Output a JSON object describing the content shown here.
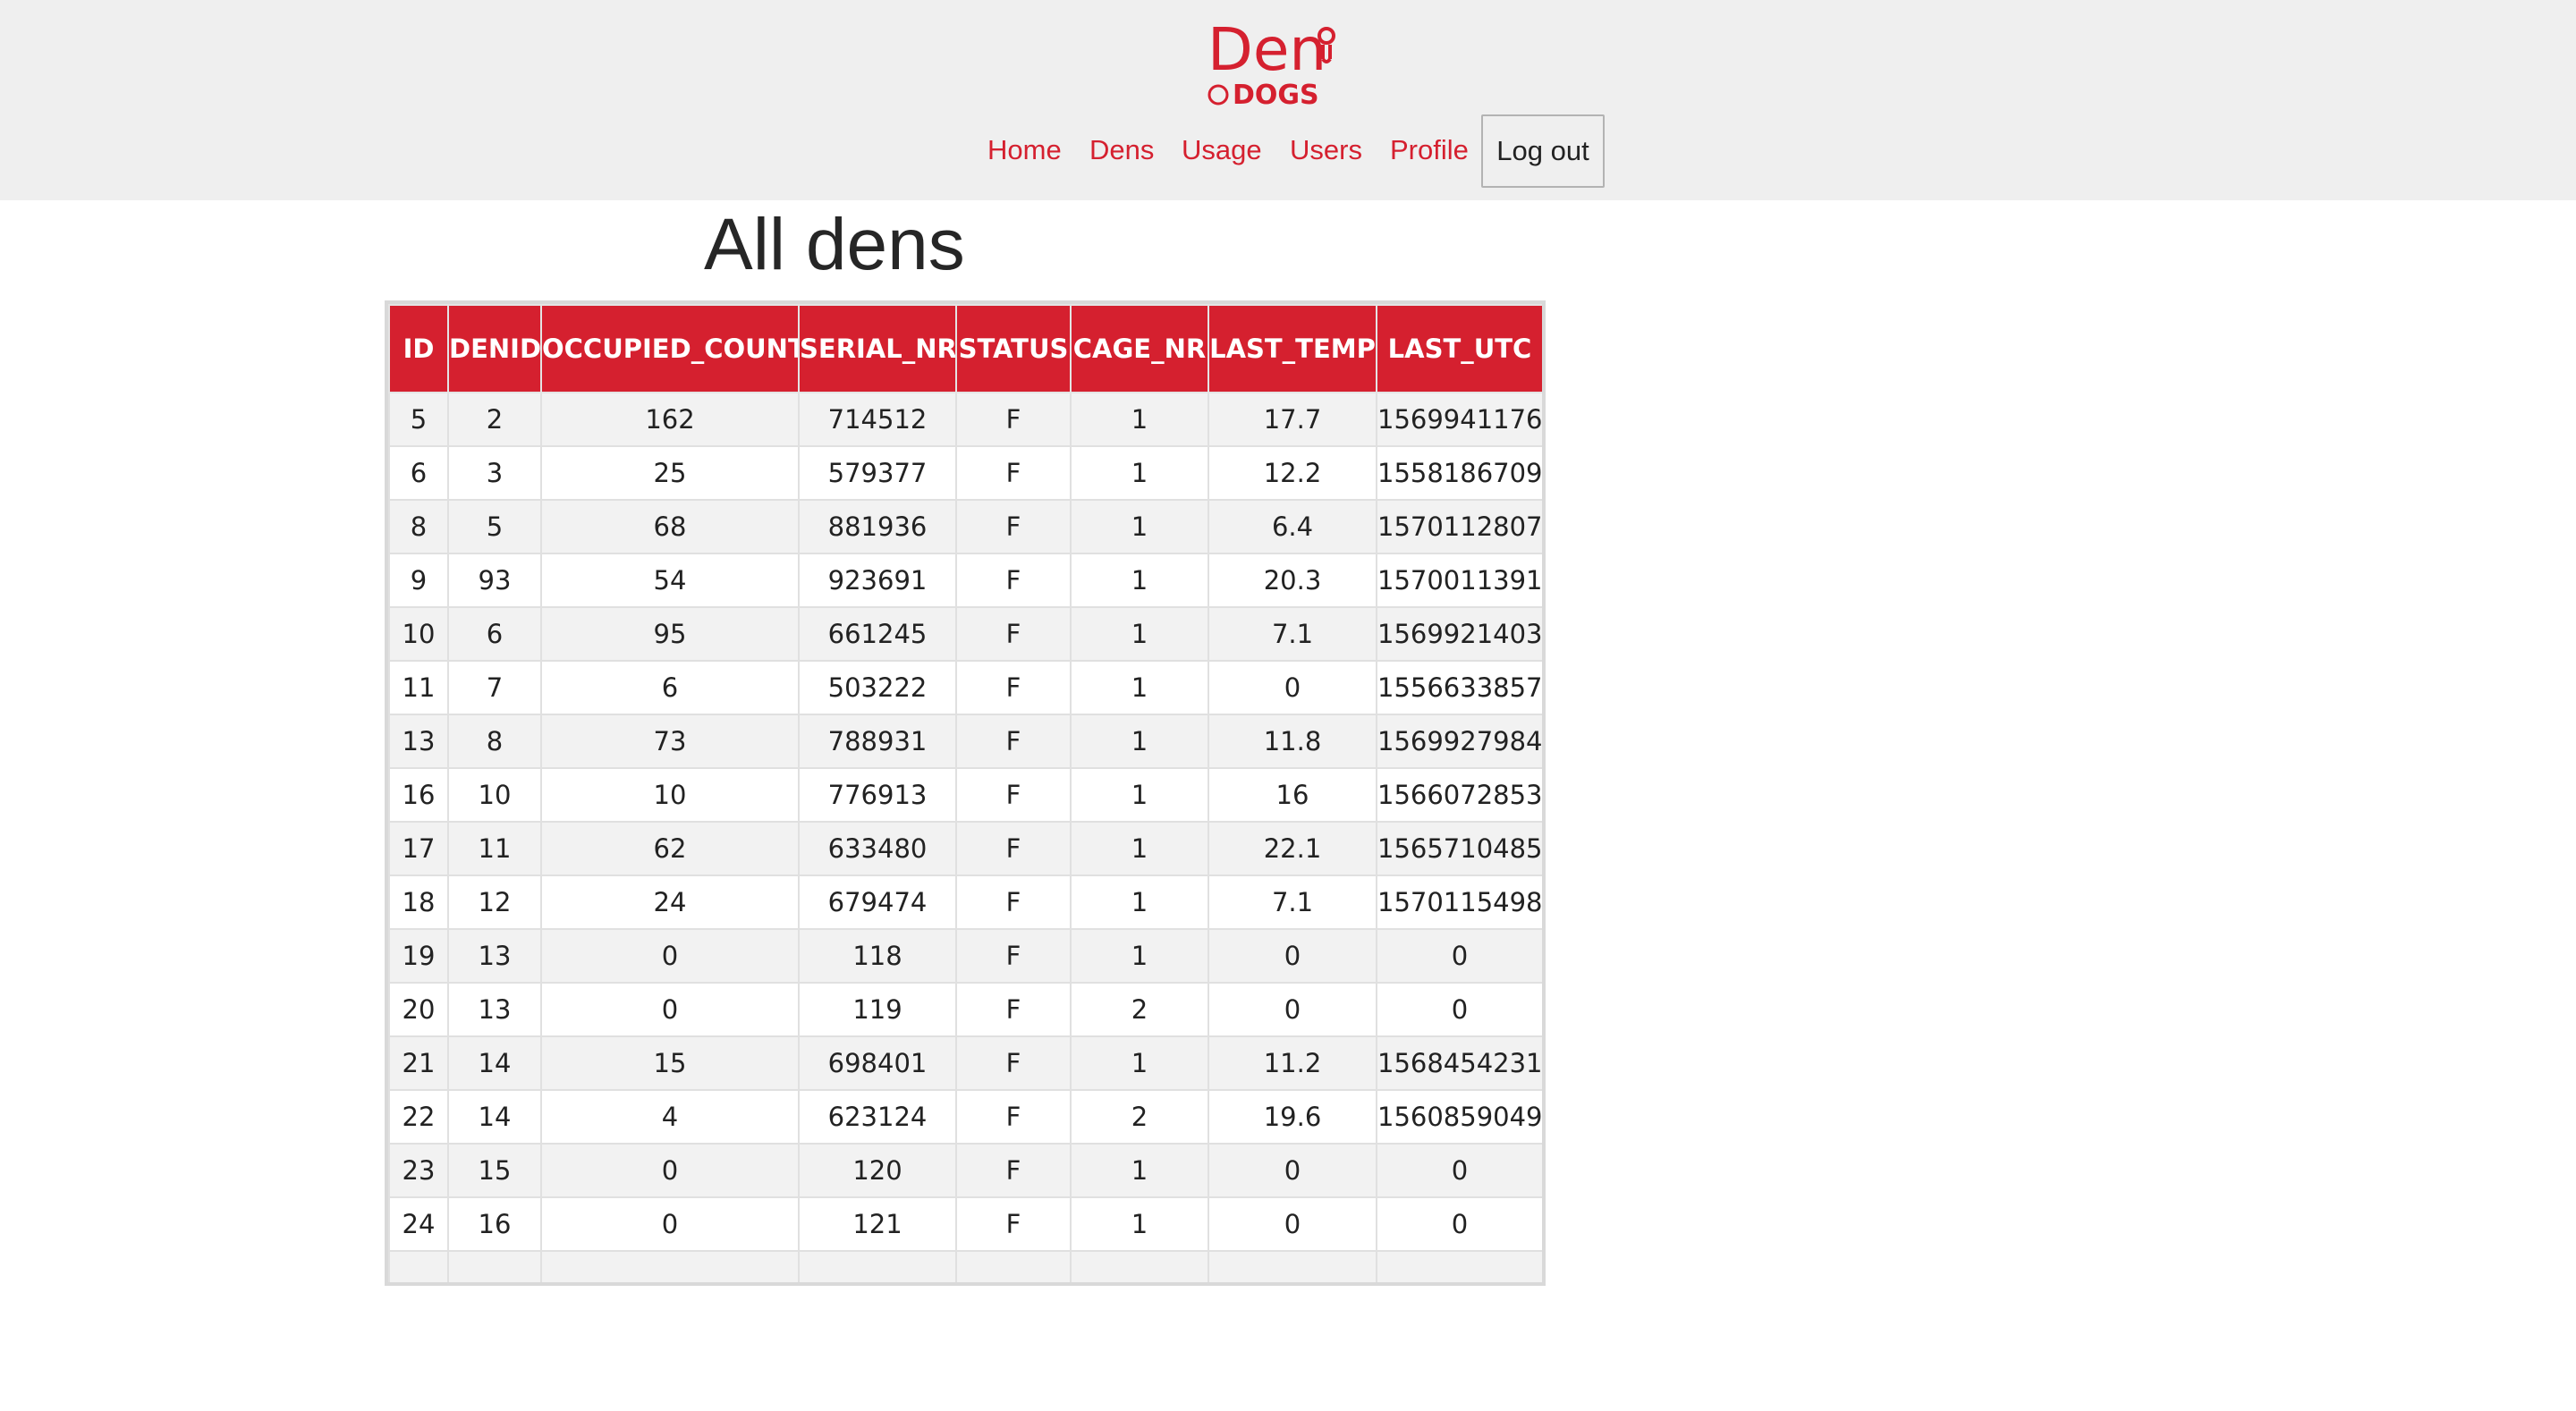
{
  "brand": {
    "logo_alt": "Den DOGS",
    "logo_main": "Den",
    "logo_sub": "DOGS",
    "color": "#d5202f"
  },
  "nav": {
    "home": "Home",
    "dens": "Dens",
    "usage": "Usage",
    "users": "Users",
    "profile": "Profile",
    "logout": "Log out"
  },
  "page": {
    "title": "All dens"
  },
  "table": {
    "headers": [
      "ID",
      "DENID",
      "OCCUPIED_COUNT",
      "SERIAL_NR",
      "STATUS",
      "CAGE_NR",
      "LAST_TEMP",
      "LAST_UTC"
    ],
    "rows": [
      [
        "5",
        "2",
        "162",
        "714512",
        "F",
        "1",
        "17.7",
        "1569941176"
      ],
      [
        "6",
        "3",
        "25",
        "579377",
        "F",
        "1",
        "12.2",
        "1558186709"
      ],
      [
        "8",
        "5",
        "68",
        "881936",
        "F",
        "1",
        "6.4",
        "1570112807"
      ],
      [
        "9",
        "93",
        "54",
        "923691",
        "F",
        "1",
        "20.3",
        "1570011391"
      ],
      [
        "10",
        "6",
        "95",
        "661245",
        "F",
        "1",
        "7.1",
        "1569921403"
      ],
      [
        "11",
        "7",
        "6",
        "503222",
        "F",
        "1",
        "0",
        "1556633857"
      ],
      [
        "13",
        "8",
        "73",
        "788931",
        "F",
        "1",
        "11.8",
        "1569927984"
      ],
      [
        "16",
        "10",
        "10",
        "776913",
        "F",
        "1",
        "16",
        "1566072853"
      ],
      [
        "17",
        "11",
        "62",
        "633480",
        "F",
        "1",
        "22.1",
        "1565710485"
      ],
      [
        "18",
        "12",
        "24",
        "679474",
        "F",
        "1",
        "7.1",
        "1570115498"
      ],
      [
        "19",
        "13",
        "0",
        "118",
        "F",
        "1",
        "0",
        "0"
      ],
      [
        "20",
        "13",
        "0",
        "119",
        "F",
        "2",
        "0",
        "0"
      ],
      [
        "21",
        "14",
        "15",
        "698401",
        "F",
        "1",
        "11.2",
        "1568454231"
      ],
      [
        "22",
        "14",
        "4",
        "623124",
        "F",
        "2",
        "19.6",
        "1560859049"
      ],
      [
        "23",
        "15",
        "0",
        "120",
        "F",
        "1",
        "0",
        "0"
      ],
      [
        "24",
        "16",
        "0",
        "121",
        "F",
        "1",
        "0",
        "0"
      ],
      [
        "",
        "",
        "",
        "",
        "",
        "",
        "",
        ""
      ]
    ]
  }
}
